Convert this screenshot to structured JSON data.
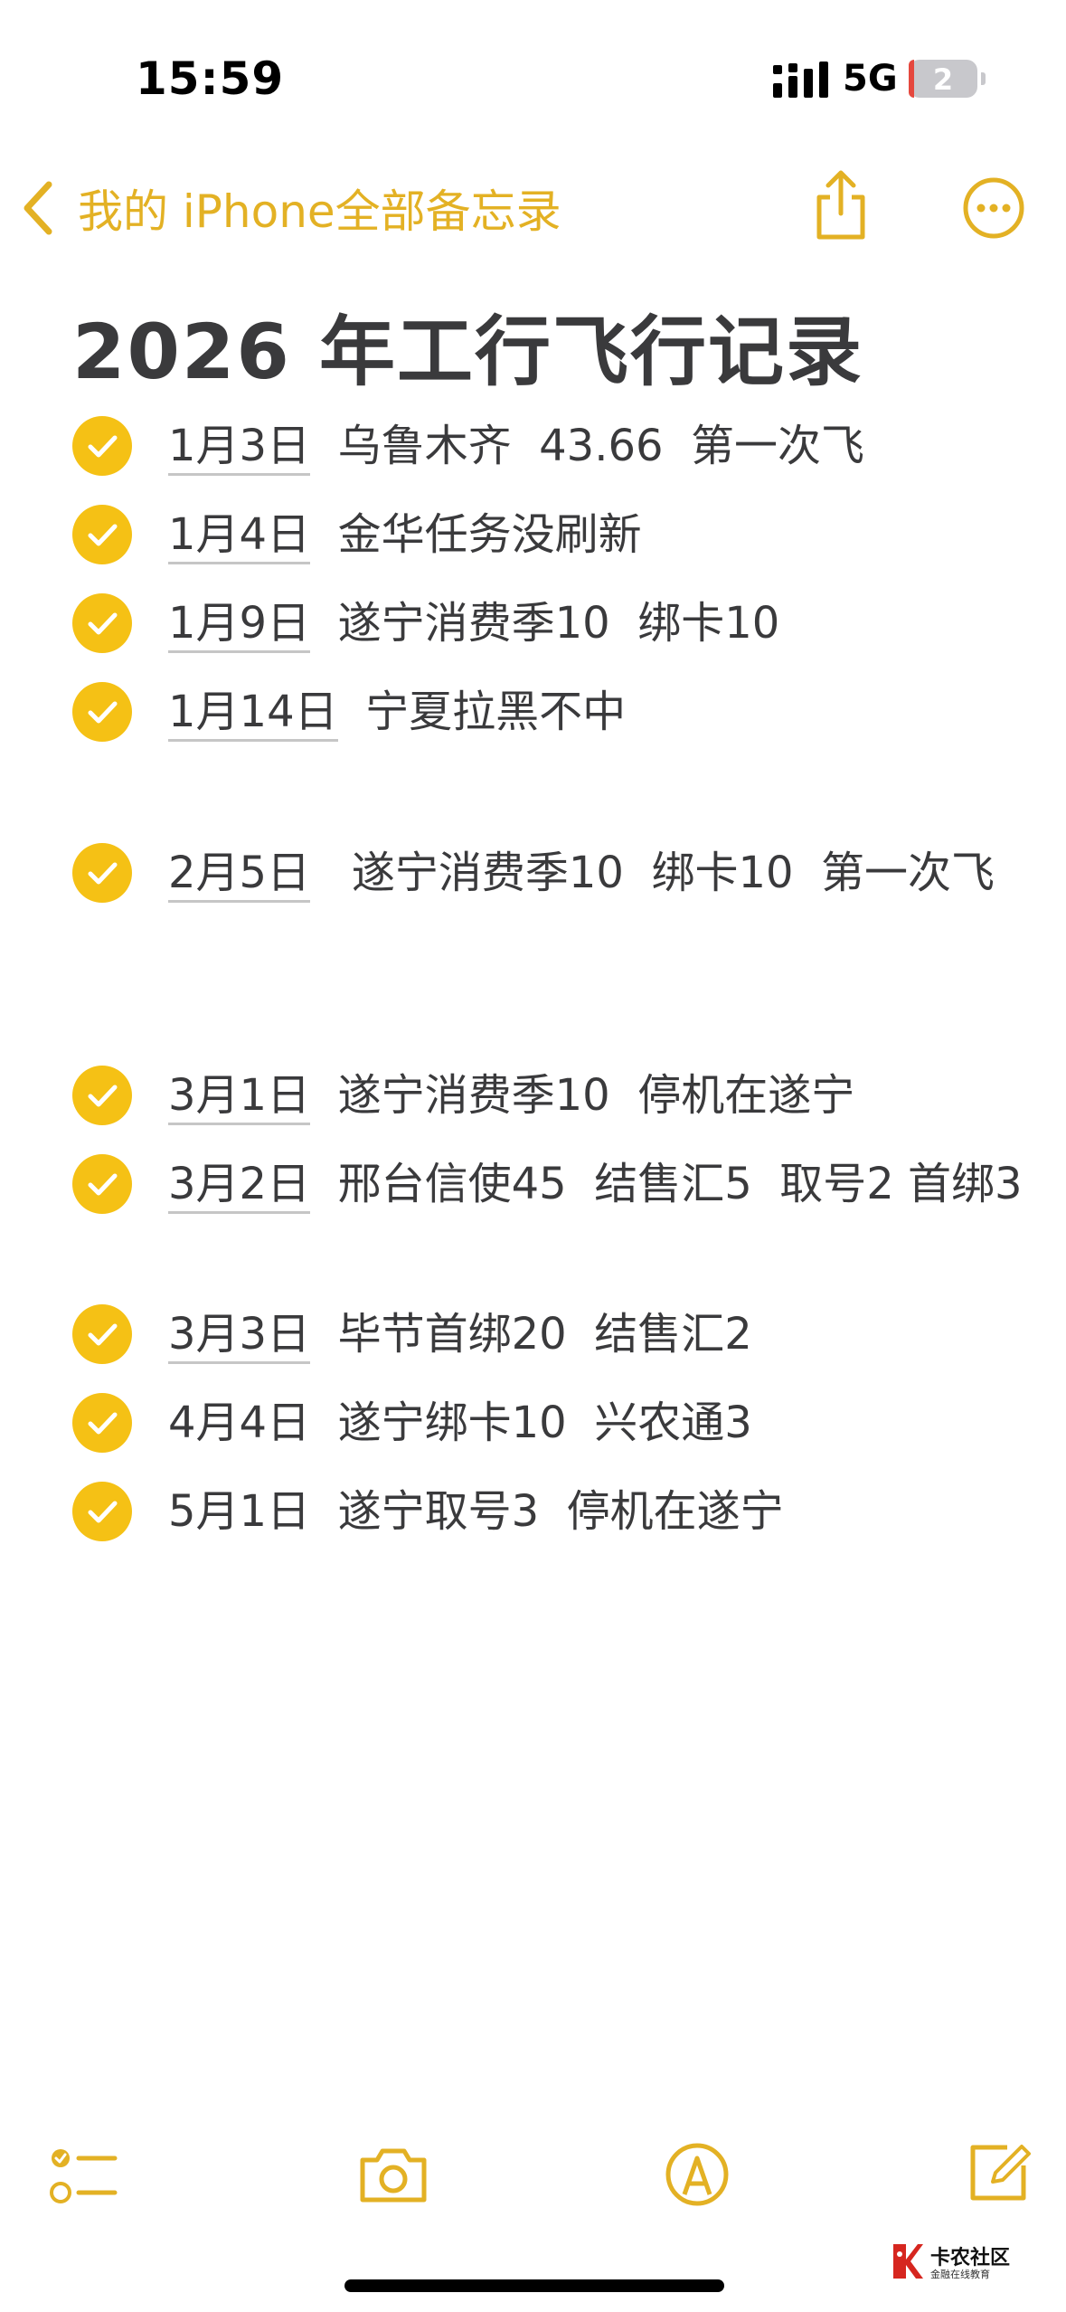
{
  "status_bar": {
    "time": "15:59",
    "network": "5G",
    "battery": "2"
  },
  "nav": {
    "back_label": "我的 iPhone全部备忘录"
  },
  "note": {
    "title": "2026 年工行飞行记录",
    "items": [
      {
        "date": "1月3日",
        "text": "  乌鲁木齐  43.66  第一次飞",
        "checked": true
      },
      {
        "date": "1月4日",
        "text": "  金华任务没刷新",
        "checked": true
      },
      {
        "date": "1月9日",
        "text": "  遂宁消费季10  绑卡10",
        "checked": true
      },
      {
        "date": "1月14日",
        "text": "  宁夏拉黑不中",
        "checked": true
      },
      {
        "date": "2月5日",
        "text": "   遂宁消费季10  绑卡10  第一次飞",
        "checked": true
      },
      {
        "date": "3月1日",
        "text": "  遂宁消费季10  停机在遂宁",
        "checked": true
      },
      {
        "date": "3月2日",
        "text": "  邢台信使45  结售汇5  取号2 首绑3",
        "checked": true
      },
      {
        "date": "3月3日",
        "text": "  毕节首绑20  结售汇2",
        "checked": true
      },
      {
        "date": "4月4日",
        "text": "  遂宁绑卡10  兴农通3",
        "checked": true
      },
      {
        "date": "5月1日",
        "text": "  遂宁取号3  停机在遂宁",
        "checked": true
      }
    ]
  },
  "watermark": {
    "title": "卡农社区",
    "subtitle": "金融在线教育"
  },
  "colors": {
    "accent": "#e3b124",
    "check_fill": "#f5c115",
    "text": "#3a3a3c"
  }
}
